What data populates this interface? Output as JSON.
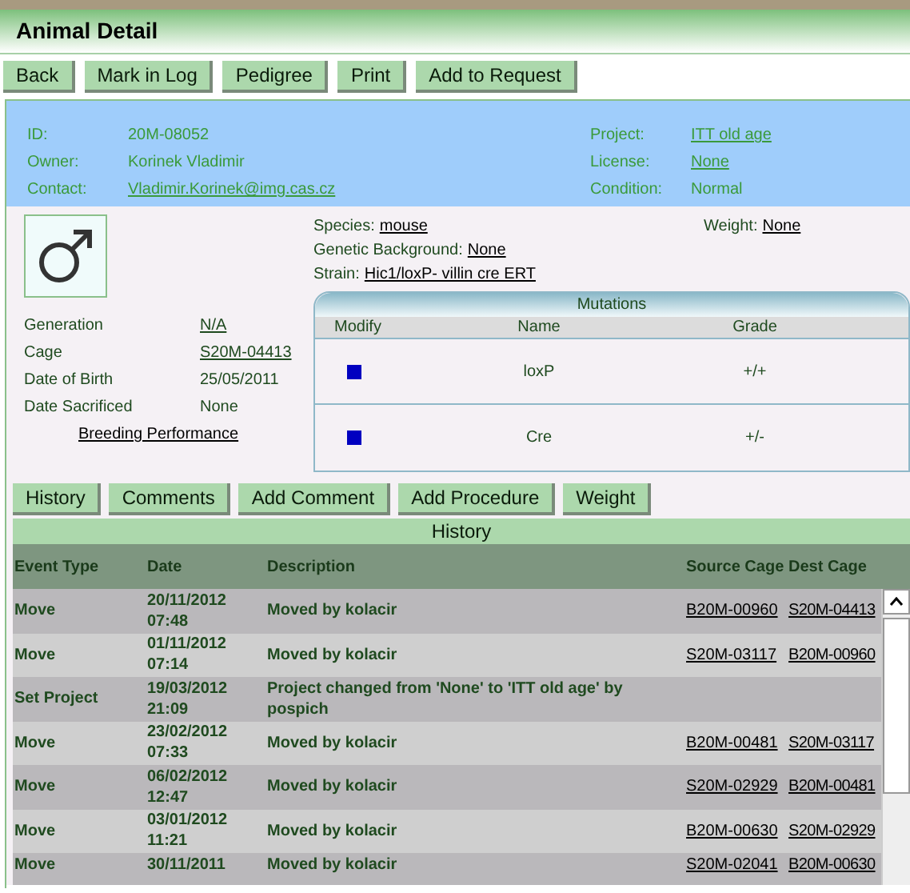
{
  "header": {
    "title": "Animal Detail"
  },
  "toolbar": [
    "Back",
    "Mark in Log",
    "Pedigree",
    "Print",
    "Add to Request"
  ],
  "info": {
    "left": [
      {
        "label": "ID:",
        "value": "20M-08052",
        "link": false
      },
      {
        "label": "Owner:",
        "value": "Korinek Vladimir",
        "link": false
      },
      {
        "label": "Contact:",
        "value": "Vladimir.Korinek@img.cas.cz",
        "link": true
      }
    ],
    "right": [
      {
        "label": "Project:",
        "value": "ITT old age",
        "link": true
      },
      {
        "label": "License:",
        "value": "None",
        "link": true
      },
      {
        "label": "Condition:",
        "value": "Normal",
        "link": false
      }
    ]
  },
  "details": [
    {
      "label": "Generation",
      "value": "N/A",
      "link": true
    },
    {
      "label": "Cage",
      "value": "S20M-04413",
      "link": true
    },
    {
      "label": "Date of Birth",
      "value": "25/05/2011",
      "link": false
    },
    {
      "label": "Date Sacrificed",
      "value": "None",
      "link": false
    }
  ],
  "breeding_link": "Breeding Performance",
  "attributes": [
    {
      "label": "Species:",
      "value": "mouse"
    },
    {
      "label": "Genetic Background:",
      "value": "None"
    },
    {
      "label": "Strain:",
      "value": "Hic1/loxP- villin cre ERT"
    }
  ],
  "weight": {
    "label": "Weight:",
    "value": "None"
  },
  "mutations": {
    "title": "Mutations",
    "columns": [
      "Modify",
      "Name",
      "Grade"
    ],
    "rows": [
      {
        "name": "loxP",
        "grade": "+/+"
      },
      {
        "name": "Cre",
        "grade": "+/-"
      }
    ]
  },
  "tabs": [
    "History",
    "Comments",
    "Add Comment",
    "Add Procedure",
    "Weight"
  ],
  "history": {
    "title": "History",
    "columns": [
      "Event Type",
      "Date",
      "Description",
      "Source Cage",
      "Dest Cage"
    ],
    "rows": [
      {
        "event": "Move",
        "date": "20/11/2012",
        "time": "07:48",
        "description": "Moved by kolacir",
        "source": "B20M-00960",
        "dest": "S20M-04413"
      },
      {
        "event": "Move",
        "date": "01/11/2012",
        "time": "07:14",
        "description": "Moved by kolacir",
        "source": "S20M-03117",
        "dest": "B20M-00960"
      },
      {
        "event": "Set Project",
        "date": "19/03/2012",
        "time": "21:09",
        "description": "Project changed from 'None' to 'ITT old age' by pospich",
        "source": "",
        "dest": ""
      },
      {
        "event": "Move",
        "date": "23/02/2012",
        "time": "07:33",
        "description": "Moved by kolacir",
        "source": "B20M-00481",
        "dest": "S20M-03117"
      },
      {
        "event": "Move",
        "date": "06/02/2012",
        "time": "12:47",
        "description": "Moved by kolacir",
        "source": "S20M-02929",
        "dest": "B20M-00481"
      },
      {
        "event": "Move",
        "date": "03/01/2012",
        "time": "11:21",
        "description": "Moved by kolacir",
        "source": "B20M-00630",
        "dest": "S20M-02929"
      },
      {
        "event": "Move",
        "date": "30/11/2011",
        "description": "Moved by kolacir",
        "source": "S20M-02041",
        "dest": "B20M-00630"
      }
    ]
  }
}
